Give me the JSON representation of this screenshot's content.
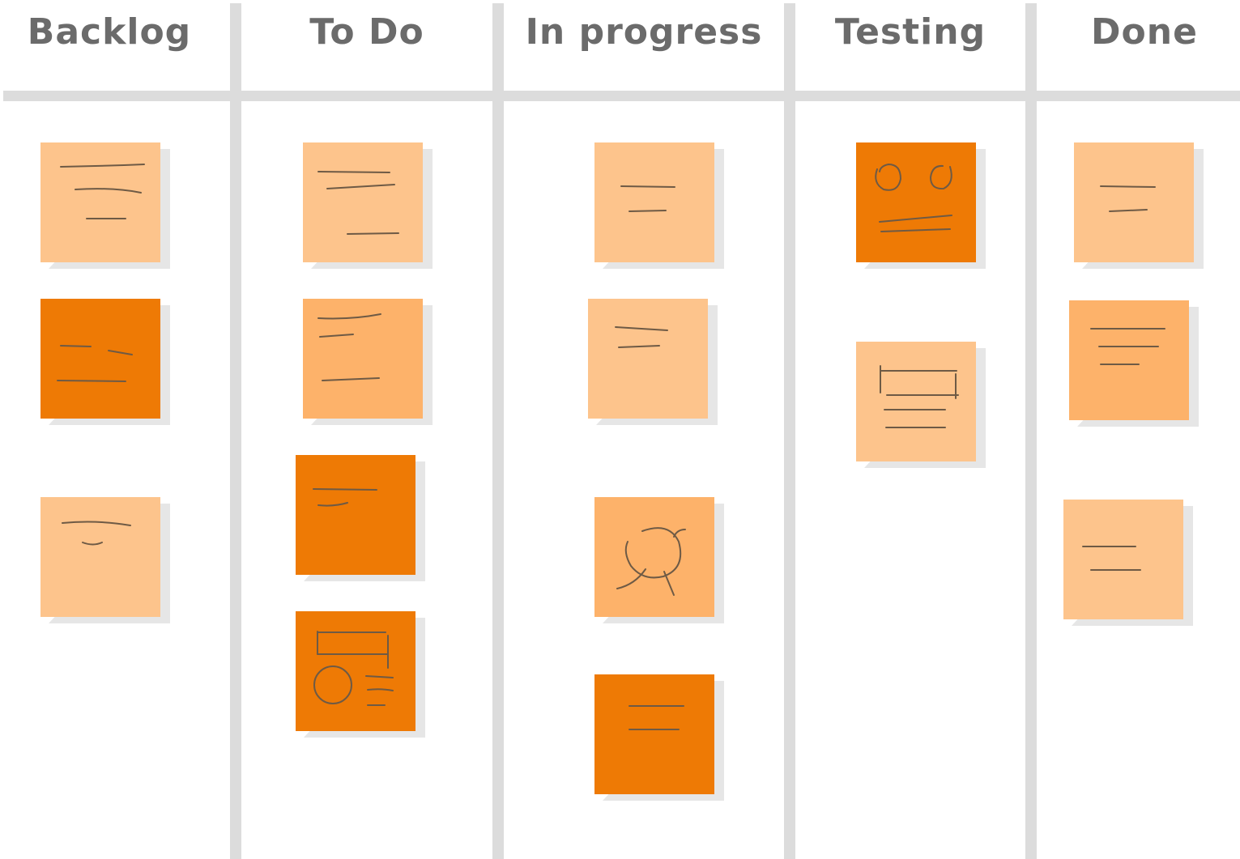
{
  "board": {
    "colors": {
      "light": "#fdc48c",
      "medium": "#fdb26a",
      "dark": "#ee7a05",
      "divider": "#dcdcdc",
      "heading": "#6b6b6b"
    },
    "columns": [
      {
        "title": "Backlog",
        "card_count": 3,
        "cards": [
          {
            "shade": "light",
            "sketch": "text-lines"
          },
          {
            "shade": "dark",
            "sketch": "text-lines"
          },
          {
            "shade": "light",
            "sketch": "text-lines"
          }
        ]
      },
      {
        "title": "To Do",
        "card_count": 4,
        "cards": [
          {
            "shade": "light",
            "sketch": "text-lines"
          },
          {
            "shade": "medium",
            "sketch": "text-lines"
          },
          {
            "shade": "dark",
            "sketch": "text-lines"
          },
          {
            "shade": "dark",
            "sketch": "wireframe-layout"
          }
        ]
      },
      {
        "title": "In progress",
        "card_count": 4,
        "cards": [
          {
            "shade": "light",
            "sketch": "text-lines"
          },
          {
            "shade": "light",
            "sketch": "text-lines"
          },
          {
            "shade": "medium",
            "sketch": "circle-diagram"
          },
          {
            "shade": "dark",
            "sketch": "text-lines"
          }
        ]
      },
      {
        "title": "Testing",
        "card_count": 2,
        "cards": [
          {
            "shade": "dark",
            "sketch": "circles-and-lines"
          },
          {
            "shade": "light",
            "sketch": "box-and-lines"
          }
        ]
      },
      {
        "title": "Done",
        "card_count": 3,
        "cards": [
          {
            "shade": "light",
            "sketch": "text-lines"
          },
          {
            "shade": "medium",
            "sketch": "text-lines"
          },
          {
            "shade": "light",
            "sketch": "text-lines"
          }
        ]
      }
    ]
  }
}
